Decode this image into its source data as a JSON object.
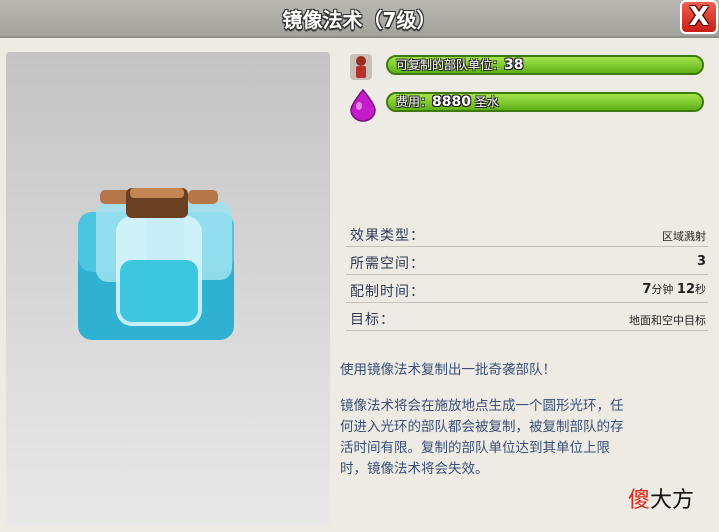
{
  "window": {
    "title": "镜像法术（7级）",
    "close_label": "X"
  },
  "stats": [
    {
      "icon": "troop-icon",
      "label": "可复制的部队单位：",
      "value": "38"
    },
    {
      "icon": "elixir-icon",
      "label": "费用：",
      "value": "8880",
      "unit": "圣水"
    }
  ],
  "info": [
    {
      "label": "效果类型：",
      "value": "区域溅射"
    },
    {
      "label": "所需空间：",
      "value": "3"
    },
    {
      "label": "配制时间：",
      "value_parts": [
        "7",
        "分钟",
        "12",
        "秒"
      ]
    },
    {
      "label": "目标：",
      "value": "地面和空中目标"
    }
  ],
  "description": {
    "tagline": "使用镜像法术复制出一批奇袭部队！",
    "lines": [
      "镜像法术将会在施放地点生成一个圆形光环，任",
      "何进入光环的部队都会被复制，被复制部队的存",
      "活时间有限。复制的部队单位达到其单位上限",
      "时，镜像法术将会失效。"
    ]
  },
  "watermark": {
    "part1": "傻",
    "part2": "大方"
  },
  "colors": {
    "bar_green": "#7ccc2a",
    "elixir": "#c51cc9",
    "close_red": "#e23a2a"
  }
}
